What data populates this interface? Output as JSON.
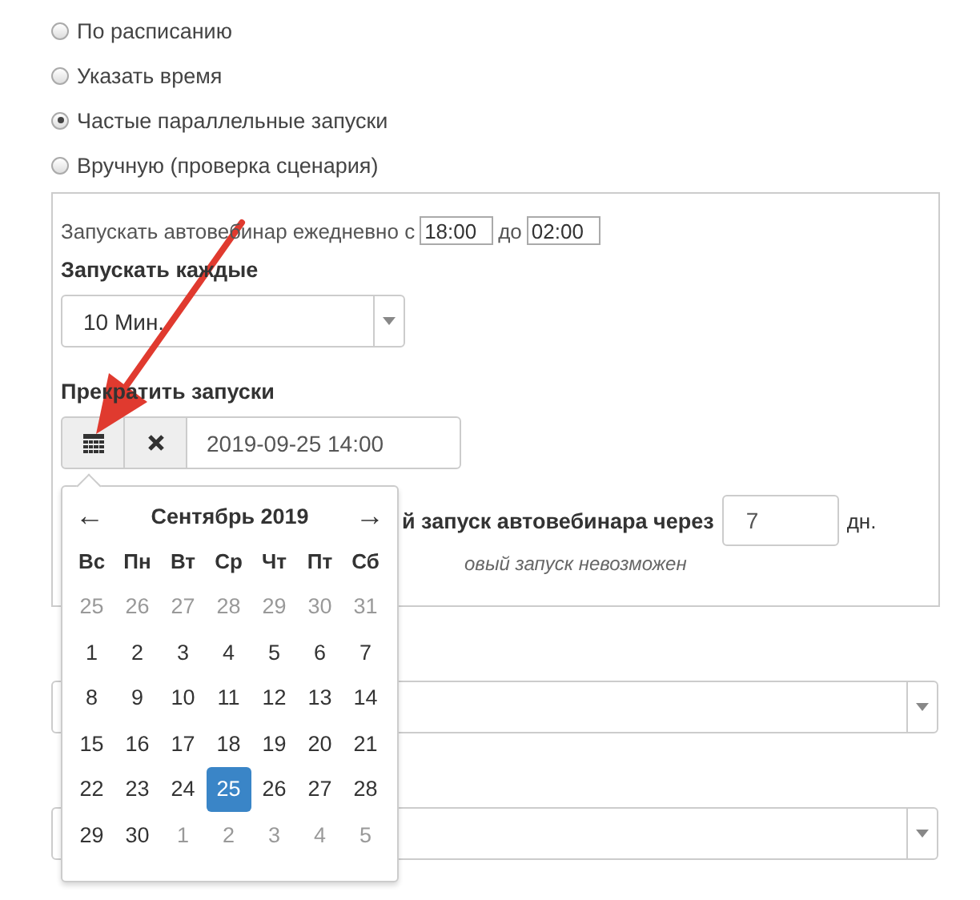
{
  "radios": [
    {
      "label": "По расписанию",
      "selected": false
    },
    {
      "label": "Указать время",
      "selected": false
    },
    {
      "label": "Частые параллельные запуски",
      "selected": true
    },
    {
      "label": "Вручную (проверка сценария)",
      "selected": false
    }
  ],
  "panel": {
    "daily_prefix": "Запускать автовебинар ежедневно с",
    "from": "18:00",
    "to_label": "до",
    "to": "02:00",
    "every_label": "Запускать каждые",
    "every_value": "10 Мин.",
    "stop_label": "Прекратить запуски",
    "stop_value": "2019-09-25 14:00",
    "next_label": "й запуск автовебинара через",
    "next_value": "7",
    "next_unit": "дн.",
    "note": "овый запуск невозможен"
  },
  "below": [
    {
      "kind": "select"
    },
    {
      "kind": "select"
    }
  ],
  "calendar": {
    "prev": "←",
    "title": "Сентябрь 2019",
    "next": "→",
    "weekdays": [
      "Вс",
      "Пн",
      "Вт",
      "Ср",
      "Чт",
      "Пт",
      "Сб"
    ],
    "weeks": [
      [
        {
          "day": "25",
          "muted": true,
          "selected": false
        },
        {
          "day": "26",
          "muted": true,
          "selected": false
        },
        {
          "day": "27",
          "muted": true,
          "selected": false
        },
        {
          "day": "28",
          "muted": true,
          "selected": false
        },
        {
          "day": "29",
          "muted": true,
          "selected": false
        },
        {
          "day": "30",
          "muted": true,
          "selected": false
        },
        {
          "day": "31",
          "muted": true,
          "selected": false
        }
      ],
      [
        {
          "day": "1",
          "muted": false,
          "selected": false
        },
        {
          "day": "2",
          "muted": false,
          "selected": false
        },
        {
          "day": "3",
          "muted": false,
          "selected": false
        },
        {
          "day": "4",
          "muted": false,
          "selected": false
        },
        {
          "day": "5",
          "muted": false,
          "selected": false
        },
        {
          "day": "6",
          "muted": false,
          "selected": false
        },
        {
          "day": "7",
          "muted": false,
          "selected": false
        }
      ],
      [
        {
          "day": "8",
          "muted": false,
          "selected": false
        },
        {
          "day": "9",
          "muted": false,
          "selected": false
        },
        {
          "day": "10",
          "muted": false,
          "selected": false
        },
        {
          "day": "11",
          "muted": false,
          "selected": false
        },
        {
          "day": "12",
          "muted": false,
          "selected": false
        },
        {
          "day": "13",
          "muted": false,
          "selected": false
        },
        {
          "day": "14",
          "muted": false,
          "selected": false
        }
      ],
      [
        {
          "day": "15",
          "muted": false,
          "selected": false
        },
        {
          "day": "16",
          "muted": false,
          "selected": false
        },
        {
          "day": "17",
          "muted": false,
          "selected": false
        },
        {
          "day": "18",
          "muted": false,
          "selected": false
        },
        {
          "day": "19",
          "muted": false,
          "selected": false
        },
        {
          "day": "20",
          "muted": false,
          "selected": false
        },
        {
          "day": "21",
          "muted": false,
          "selected": false
        }
      ],
      [
        {
          "day": "22",
          "muted": false,
          "selected": false
        },
        {
          "day": "23",
          "muted": false,
          "selected": false
        },
        {
          "day": "24",
          "muted": false,
          "selected": false
        },
        {
          "day": "25",
          "muted": false,
          "selected": true
        },
        {
          "day": "26",
          "muted": false,
          "selected": false
        },
        {
          "day": "27",
          "muted": false,
          "selected": false
        },
        {
          "day": "28",
          "muted": false,
          "selected": false
        }
      ],
      [
        {
          "day": "29",
          "muted": false,
          "selected": false
        },
        {
          "day": "30",
          "muted": false,
          "selected": false
        },
        {
          "day": "1",
          "muted": true,
          "selected": false
        },
        {
          "day": "2",
          "muted": true,
          "selected": false
        },
        {
          "day": "3",
          "muted": true,
          "selected": false
        },
        {
          "day": "4",
          "muted": true,
          "selected": false
        },
        {
          "day": "5",
          "muted": true,
          "selected": false
        }
      ]
    ]
  }
}
